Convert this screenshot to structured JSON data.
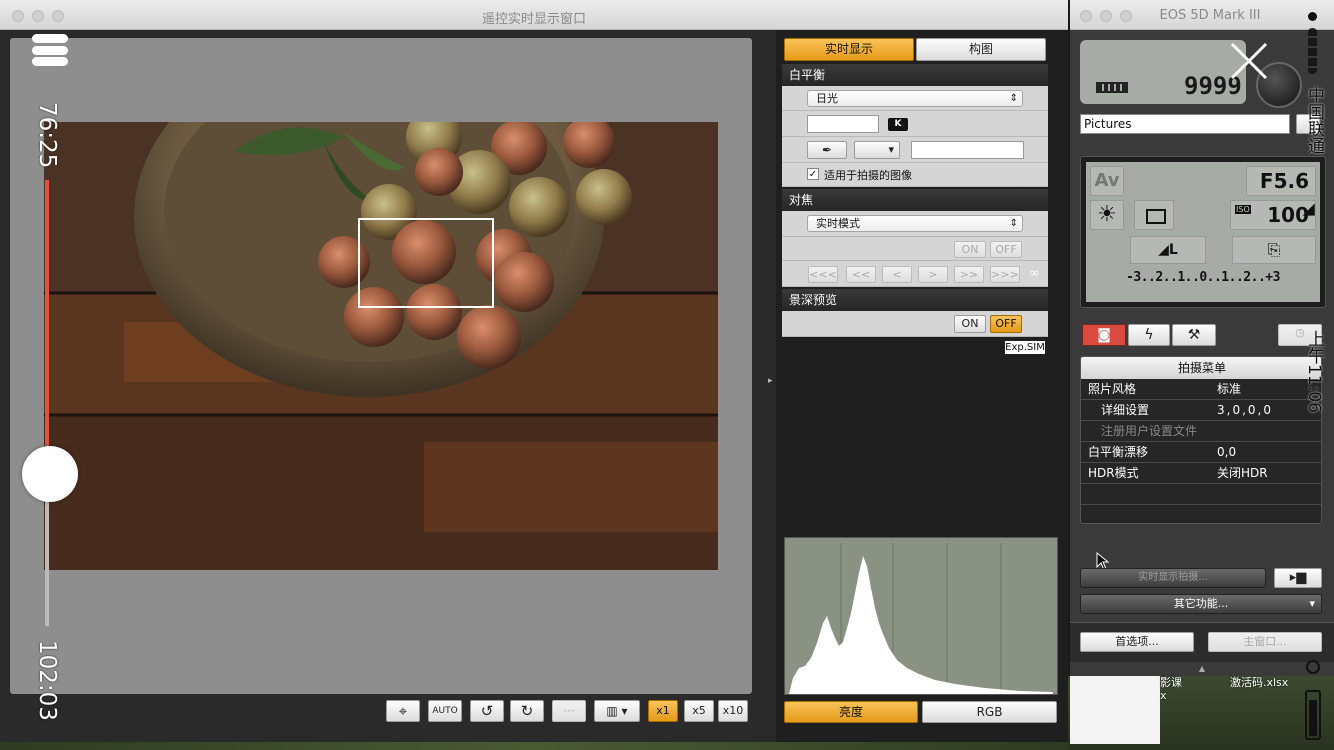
{
  "left_window": {
    "title": "遥控实时显示窗口",
    "toolbar": {
      "auto_label": "AUTO",
      "zoom_x1": "x1",
      "zoom_x5": "x5",
      "zoom_x10": "x10"
    }
  },
  "live_panel": {
    "tabs": [
      "实时显示",
      "构图"
    ],
    "white_balance": {
      "header": "白平衡",
      "preset": "日光",
      "k_label": "K",
      "apply_label": "适用于拍摄的图像",
      "apply_checked": true
    },
    "focus": {
      "header": "对焦",
      "mode": "实时模式",
      "on": "ON",
      "off": "OFF",
      "buttons": [
        "<<<",
        "<<",
        "<",
        ">",
        ">>",
        ">>>"
      ],
      "infinity": "∞"
    },
    "dof": {
      "header": "景深预览",
      "on": "ON",
      "off": "OFF",
      "exp_sim": "Exp.SIM"
    },
    "histogram_tabs": [
      "亮度",
      "RGB"
    ]
  },
  "right_window": {
    "title": "EOS 5D Mark III",
    "shots_remaining": "9999",
    "folder": "Pictures",
    "mode": "Av",
    "aperture": "F5.6",
    "iso_label": "ISO",
    "iso": "100",
    "exposure_scale": "-3..2..1..0..1..2..+3",
    "menu": {
      "title": "拍摄菜单",
      "rows": [
        {
          "label": "照片风格",
          "value": "标准",
          "indent": false,
          "disabled": false
        },
        {
          "label": "详细设置",
          "value": "3,0,0,0",
          "indent": true,
          "disabled": false
        },
        {
          "label": "注册用户设置文件",
          "value": "",
          "indent": true,
          "disabled": true
        },
        {
          "label": "白平衡漂移",
          "value": "0,0",
          "indent": false,
          "disabled": false
        },
        {
          "label": "HDR模式",
          "value": "关闭HDR",
          "indent": false,
          "disabled": false
        }
      ]
    },
    "live_shoot_button": "实时显示拍摄...",
    "other_functions": "其它功能...",
    "preferences": "首选项...",
    "main_window": "主窗口..."
  },
  "video_overlay": {
    "elapsed": "76:25",
    "total": "102:03",
    "progress": 0.75,
    "carrier": "中国联通",
    "clock": "上午11:06"
  },
  "background": {
    "file1": "激活码.xlsx",
    "file2": "影课",
    "file3": "x"
  },
  "colors": {
    "accent": "#f0a32a",
    "progress": "#e0533e"
  }
}
